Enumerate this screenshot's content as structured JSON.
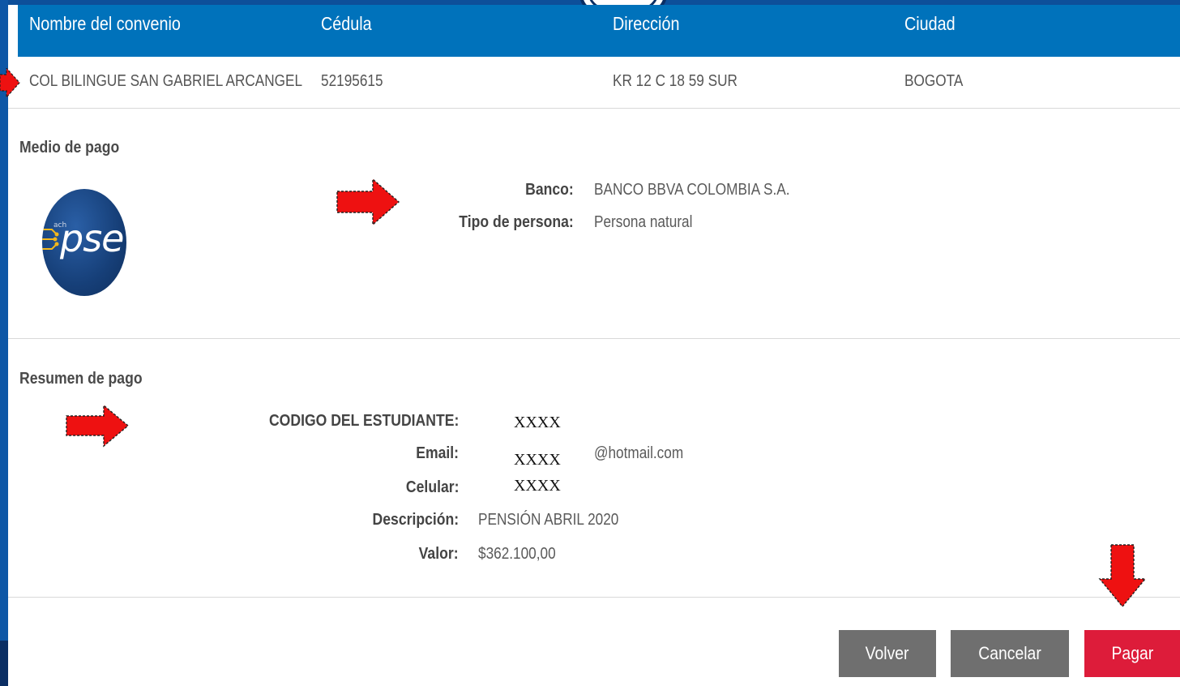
{
  "table": {
    "headers": [
      "Nombre del convenio",
      "Cédula",
      "Dirección",
      "Ciudad"
    ],
    "row": [
      "COL BILINGUE SAN GABRIEL ARCANGEL",
      "52195615",
      "KR 12 C 18 59 SUR",
      "BOGOTA"
    ]
  },
  "medio_pago": {
    "title": "Medio de pago",
    "logo": {
      "brand": "pse",
      "small": "ach"
    },
    "banco_label": "Banco:",
    "banco_value": "BANCO BBVA COLOMBIA S.A.",
    "tipo_label": "Tipo de persona:",
    "tipo_value": "Persona natural"
  },
  "resumen": {
    "title": "Resumen de pago",
    "codigo_label": "CODIGO DEL ESTUDIANTE:",
    "codigo_value": "XXXX",
    "email_label": "Email:",
    "email_mask": "XXXX",
    "email_domain": "@hotmail.com",
    "celular_label": "Celular:",
    "celular_value": "XXXX",
    "descripcion_label": "Descripción:",
    "descripcion_value": "PENSIÓN ABRIL 2020",
    "valor_label": "Valor:",
    "valor_value": "$362.100,00"
  },
  "buttons": {
    "volver": "Volver",
    "cancelar": "Cancelar",
    "pagar": "Pagar"
  },
  "colors": {
    "header_blue": "#0072bb",
    "pagar_red": "#dd1c3a",
    "button_grey": "#6f6f6f",
    "arrow_red": "#ee1111"
  },
  "icons": [
    "arrow-right-icon",
    "arrow-down-icon",
    "pse-logo"
  ]
}
